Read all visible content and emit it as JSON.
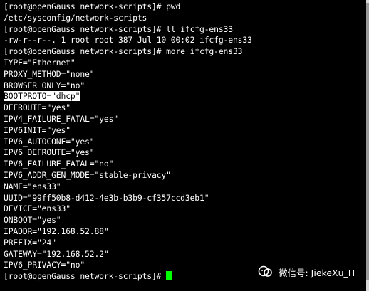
{
  "terminal": {
    "lines": [
      "[root@openGauss network-scripts]# pwd",
      "/etc/sysconfig/network-scripts",
      "[root@openGauss network-scripts]# ll ifcfg-ens33",
      "-rw-r--r--. 1 root root 387 Jul 10 00:02 ifcfg-ens33",
      "[root@openGauss network-scripts]# more ifcfg-ens33",
      "TYPE=\"Ethernet\"",
      "PROXY_METHOD=\"none\"",
      "BROWSER_ONLY=\"no\"",
      "BOOTPROTO=\"dhcp\"",
      "DEFROUTE=\"yes\"",
      "IPV4_FAILURE_FATAL=\"yes\"",
      "IPV6INIT=\"yes\"",
      "IPV6_AUTOCONF=\"yes\"",
      "IPV6_DEFROUTE=\"yes\"",
      "IPV6_FAILURE_FATAL=\"no\"",
      "IPV6_ADDR_GEN_MODE=\"stable-privacy\"",
      "NAME=\"ens33\"",
      "UUID=\"99ff50b8-d412-4e3b-b3b9-cf357ccd3eb1\"",
      "DEVICE=\"ens33\"",
      "ONBOOT=\"yes\"",
      "IPADDR=\"192.168.52.88\"",
      "PREFIX=\"24\"",
      "GATEWAY=\"192.168.52.2\"",
      "IPV6_PRIVACY=\"no\""
    ],
    "prompt": "[root@openGauss network-scripts]# ",
    "selected_line_index": 8,
    "colors": {
      "background": "#000000",
      "foreground": "#ffffff",
      "cursor": "#00ff00",
      "selection": "#ffffff"
    }
  },
  "watermark": {
    "text": "微信号: JiekeXu_IT",
    "icon": "wechat-official-account-icon"
  }
}
